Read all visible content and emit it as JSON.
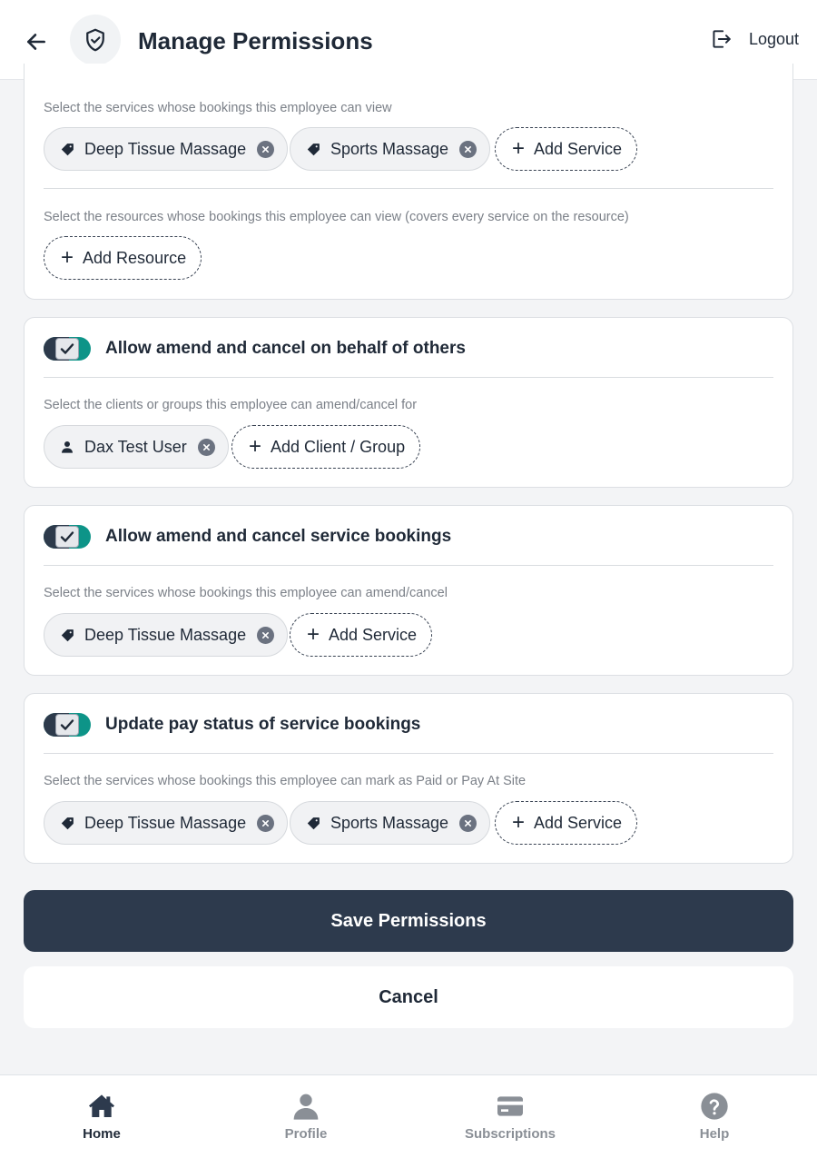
{
  "header": {
    "title": "Manage Permissions",
    "logout_label": "Logout"
  },
  "view_section": {
    "services_hint": "Select the services whose bookings this employee can view",
    "services": [
      "Deep Tissue Massage",
      "Sports Massage"
    ],
    "add_service_label": "Add Service",
    "resources_hint": "Select the resources whose bookings this employee can view (covers every service on the resource)",
    "add_resource_label": "Add Resource"
  },
  "amend_others": {
    "toggle_on": true,
    "title": "Allow amend and cancel on behalf of others",
    "hint": "Select the clients or groups this employee can amend/cancel for",
    "clients": [
      "Dax Test User"
    ],
    "add_label": "Add Client / Group"
  },
  "amend_services": {
    "toggle_on": true,
    "title": "Allow amend and cancel service bookings",
    "hint": "Select the services whose bookings this employee can amend/cancel",
    "services": [
      "Deep Tissue Massage"
    ],
    "add_label": "Add Service"
  },
  "pay_status": {
    "toggle_on": true,
    "title": "Update pay status of service bookings",
    "hint": "Select the services whose bookings this employee can mark as Paid or Pay At Site",
    "services": [
      "Deep Tissue Massage",
      "Sports Massage"
    ],
    "add_label": "Add Service"
  },
  "actions": {
    "save_label": "Save Permissions",
    "cancel_label": "Cancel"
  },
  "bottom_nav": {
    "items": [
      {
        "label": "Home",
        "icon": "home-icon",
        "active": true
      },
      {
        "label": "Profile",
        "icon": "person-icon",
        "active": false
      },
      {
        "label": "Subscriptions",
        "icon": "card-icon",
        "active": false
      },
      {
        "label": "Help",
        "icon": "help-icon",
        "active": false
      }
    ]
  },
  "colors": {
    "primary_dark": "#2d3a4d",
    "toggle_accent": "#0d9488",
    "background": "#f3f4f6"
  }
}
